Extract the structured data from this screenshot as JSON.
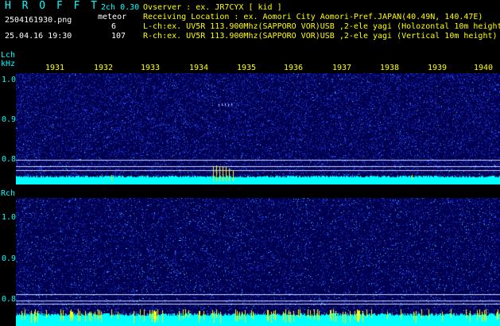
{
  "app": {
    "logo": "H R O F F T",
    "version": "2ch 0.30",
    "filename": "2504161930.png",
    "datetime": "25.04.16 19:30",
    "meteor_label": "meteor",
    "lch_count": "6",
    "rch_count": "107"
  },
  "info": {
    "observer": "Ovserver                 : ex. JR7CYX [ kid ]",
    "location": "Receiving Location : ex. Aomori City Aomori-Pref.JAPAN(40.49N, 140.47E)",
    "lch": "L-ch:ex. UV5R 113.900Mhz(SAPPORO VOR)USB ,2-ele yagi (Holozontal 10m height)",
    "rch": "R-ch:ex. UV5R 113.900Mhz(SAPPORO VOR)USB ,2-ele yagi (Vertical 10m height)"
  },
  "axes": {
    "lch_label": "Lch",
    "khz_label": "kHz",
    "rch_label": "Rch",
    "time_ticks": [
      "1931",
      "1932",
      "1933",
      "1934",
      "1935",
      "1936",
      "1937",
      "1938",
      "1939",
      "1940"
    ],
    "freq_ticks": [
      "1.0",
      "0.9",
      "0.8"
    ]
  },
  "colors": {
    "background": "#000000",
    "noise_dark": "#000050",
    "noise_blue": "#2040ff",
    "noise_cyan": "#00ffff",
    "meteor": "#ffff00",
    "reference_line": "#ffffff"
  }
}
